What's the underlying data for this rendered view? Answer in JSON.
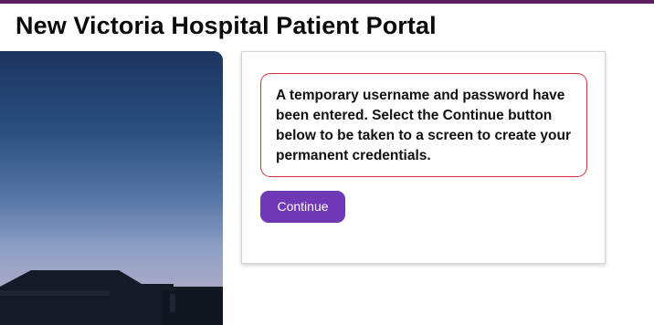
{
  "header": {
    "title": "New Victoria Hospital Patient Portal",
    "accent_color": "#5a1d5e"
  },
  "notice": {
    "message": "A temporary username and password have been entered. Select the Continue button below to be taken to a screen to create your permanent credentials.",
    "border_color": "#d0343a"
  },
  "actions": {
    "continue_label": "Continue",
    "button_color": "#6f39b5"
  }
}
